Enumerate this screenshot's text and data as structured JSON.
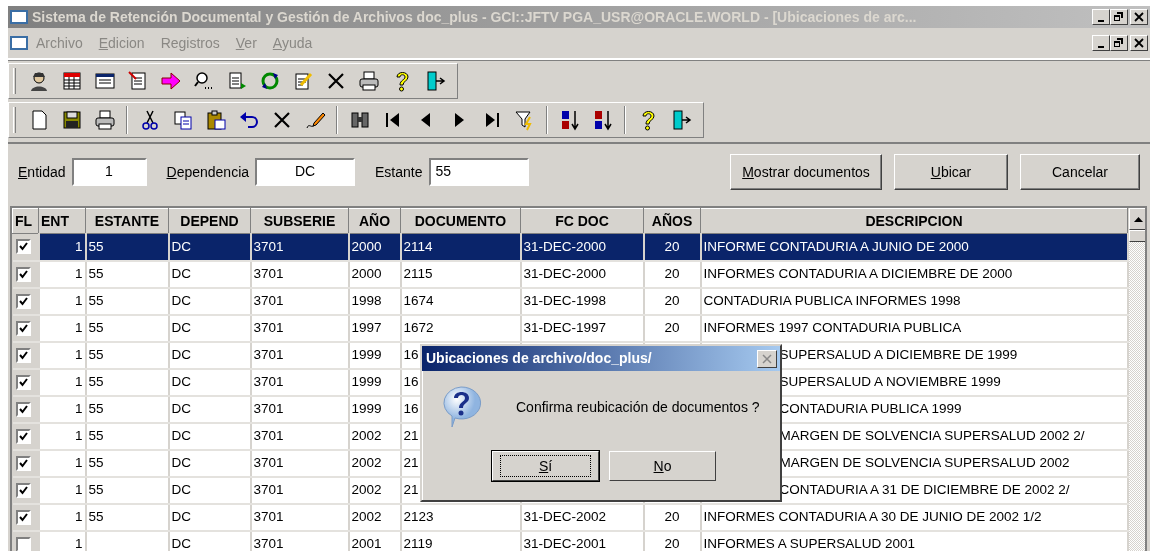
{
  "window": {
    "title": "Sistema de Retención Documental y Gestión de Archivos doc_plus - GCI::JFTV  PGA_USR@ORACLE.WORLD - [Ubicaciones de arc..."
  },
  "menu": [
    {
      "label": "Archivo",
      "underline_first": false
    },
    {
      "label": "Edicion",
      "underline_first": true
    },
    {
      "label": "Registros",
      "underline_first": false
    },
    {
      "label": "Ver",
      "underline_first": true
    },
    {
      "label": "Ayuda",
      "underline_first": true
    }
  ],
  "form": {
    "fields": [
      {
        "label": "Entidad",
        "value": "1",
        "underline_first": true
      },
      {
        "label": "Dependencia",
        "value": "DC",
        "underline_first": true
      },
      {
        "label": "Estante",
        "value": "55",
        "underline_first": false
      }
    ],
    "buttons": [
      {
        "label": "Mostrar documentos",
        "underline_first": true
      },
      {
        "label": "Ubicar",
        "underline_first": true
      },
      {
        "label": "Cancelar",
        "underline_first": false
      }
    ]
  },
  "table": {
    "columns": [
      "FL",
      "ENT",
      "ESTANTE",
      "DEPEND",
      "SUBSERIE",
      "AÑO",
      "DOCUMENTO",
      "FC DOC",
      "AÑOS",
      "DESCRIPCION"
    ],
    "rows": [
      {
        "checked": true,
        "selected": true,
        "covered": false,
        "ent": "1",
        "estante": "55",
        "depend": "DC",
        "subserie": "3701",
        "ano": "2000",
        "documento": "2114",
        "fc_doc": "31-DEC-2000",
        "anos": "20",
        "descripcion": "INFORME CONTADURIA A JUNIO DE 2000"
      },
      {
        "checked": true,
        "selected": false,
        "covered": false,
        "ent": "1",
        "estante": "55",
        "depend": "DC",
        "subserie": "3701",
        "ano": "2000",
        "documento": "2115",
        "fc_doc": "31-DEC-2000",
        "anos": "20",
        "descripcion": "INFORMES CONTADURIA A DICIEMBRE DE 2000"
      },
      {
        "checked": true,
        "selected": false,
        "covered": false,
        "ent": "1",
        "estante": "55",
        "depend": "DC",
        "subserie": "3701",
        "ano": "1998",
        "documento": "1674",
        "fc_doc": "31-DEC-1998",
        "anos": "20",
        "descripcion": "CONTADURIA PUBLICA INFORMES 1998"
      },
      {
        "checked": true,
        "selected": false,
        "covered": false,
        "ent": "1",
        "estante": "55",
        "depend": "DC",
        "subserie": "3701",
        "ano": "1997",
        "documento": "1672",
        "fc_doc": "31-DEC-1997",
        "anos": "20",
        "descripcion": "INFORMES 1997 CONTADURIA PUBLICA"
      },
      {
        "checked": true,
        "selected": false,
        "covered": true,
        "ent": "1",
        "estante": "55",
        "depend": "DC",
        "subserie": "3701",
        "ano": "1999",
        "documento": "16",
        "descripcion": "SUPERSALUD A DICIEMBRE DE 1999"
      },
      {
        "checked": true,
        "selected": false,
        "covered": true,
        "ent": "1",
        "estante": "55",
        "depend": "DC",
        "subserie": "3701",
        "ano": "1999",
        "documento": "16",
        "descripcion": "SUPERSALUD A NOVIEMBRE 1999"
      },
      {
        "checked": true,
        "selected": false,
        "covered": true,
        "ent": "1",
        "estante": "55",
        "depend": "DC",
        "subserie": "3701",
        "ano": "1999",
        "documento": "16",
        "descripcion": "CONTADURIA PUBLICA 1999"
      },
      {
        "checked": true,
        "selected": false,
        "covered": true,
        "ent": "1",
        "estante": "55",
        "depend": "DC",
        "subserie": "3701",
        "ano": "2002",
        "documento": "21",
        "descripcion": "MARGEN DE SOLVENCIA SUPERSALUD 2002 2/"
      },
      {
        "checked": true,
        "selected": false,
        "covered": true,
        "ent": "1",
        "estante": "55",
        "depend": "DC",
        "subserie": "3701",
        "ano": "2002",
        "documento": "21",
        "descripcion": "MARGEN DE SOLVENCIA SUPERSALUD 2002"
      },
      {
        "checked": true,
        "selected": false,
        "covered": true,
        "ent": "1",
        "estante": "55",
        "depend": "DC",
        "subserie": "3701",
        "ano": "2002",
        "documento": "21",
        "descripcion": "CONTADURIA A 31 DE DICIEMBRE DE 2002  2/"
      },
      {
        "checked": true,
        "selected": false,
        "covered": false,
        "ent": "1",
        "estante": "55",
        "depend": "DC",
        "subserie": "3701",
        "ano": "2002",
        "documento": "2123",
        "fc_doc": "31-DEC-2002",
        "anos": "20",
        "descripcion": "INFORMES CONTADURIA A 30 DE JUNIO DE 2002 1/2"
      },
      {
        "checked": false,
        "selected": false,
        "covered": false,
        "ent": "1",
        "depend": "DC",
        "subserie": "3701",
        "ano": "2001",
        "documento": "2119",
        "fc_doc": "31-DEC-2001",
        "anos": "20",
        "descripcion": "INFORMES A SUPERSALUD 2001"
      }
    ]
  },
  "dialog": {
    "title": "Ubicaciones de archivo/doc_plus/",
    "message": "Confirma reubicación de documentos ?",
    "buttons": [
      {
        "label": "Sí",
        "default": true,
        "underline_first": true
      },
      {
        "label": "No",
        "default": false,
        "underline_first": true
      }
    ]
  }
}
